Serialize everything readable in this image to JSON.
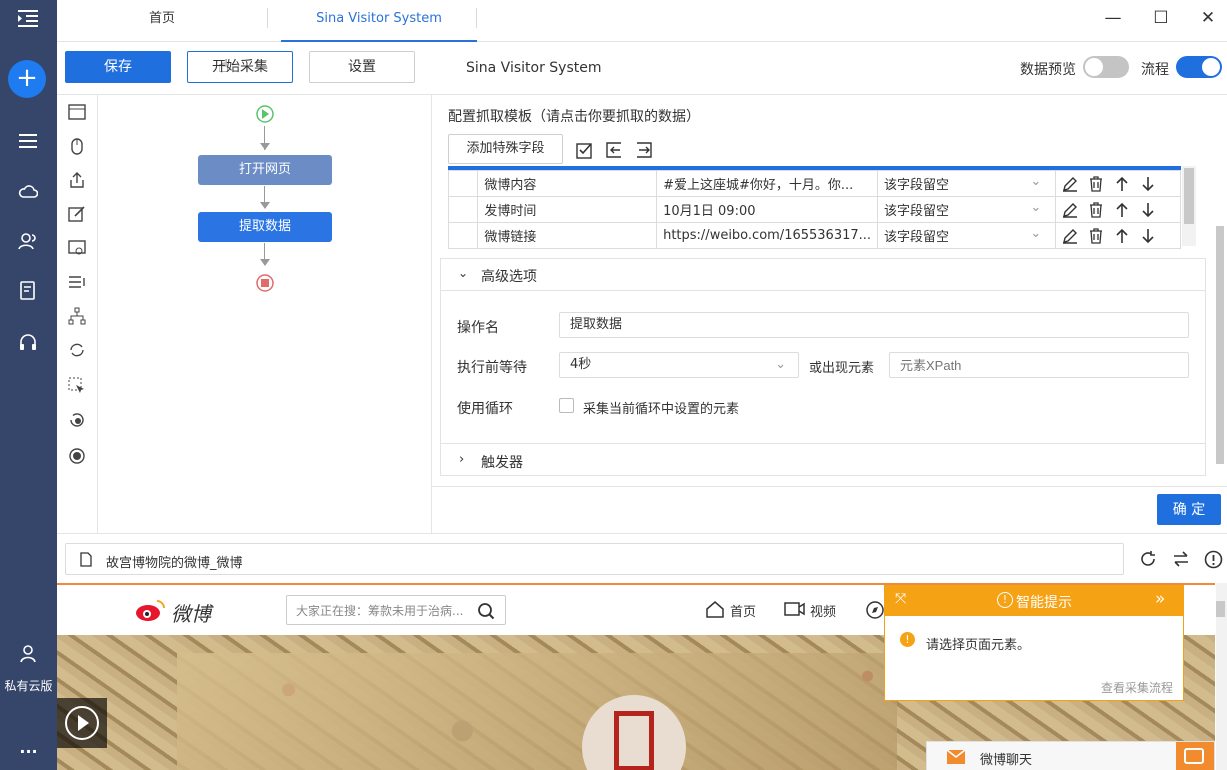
{
  "app": {
    "tabs": [
      {
        "label": "首页"
      },
      {
        "label": "Sina Visitor System"
      }
    ],
    "rail": {
      "cloud_label": "私有云版",
      "more_label": "..."
    }
  },
  "toolbar": {
    "save_label": "保存",
    "start_label": "开始采集",
    "settings_label": "设置",
    "task_title": "Sina Visitor System",
    "preview_label": "数据预览",
    "preview_on": false,
    "flow_label": "流程",
    "flow_on": true
  },
  "flow": {
    "nodes": [
      {
        "label": "打开网页"
      },
      {
        "label": "提取数据"
      }
    ]
  },
  "extract": {
    "heading": "配置抓取模板（请点击你要抓取的数据）",
    "add_special_label": "添加特殊字段",
    "rows": [
      {
        "name": "微博内容",
        "value": "#爱上这座城#你好，十月。你...",
        "option": "该字段留空"
      },
      {
        "name": "发博时间",
        "value": "10月1日 09:00",
        "option": "该字段留空"
      },
      {
        "name": "微博链接",
        "value": "https://weibo.com/165536317...",
        "option": "该字段留空"
      }
    ],
    "advanced_label": "高级选项",
    "op_name_label": "操作名",
    "op_name_value": "提取数据",
    "wait_label": "执行前等待",
    "wait_value": "4秒",
    "or_label": "或出现元素",
    "xpath_placeholder": "元素XPath",
    "loop_label": "使用循环",
    "loop_checkbox_label": "采集当前循环中设置的元素",
    "trigger_label": "触发器",
    "confirm_label": "确 定"
  },
  "browser": {
    "page_title": "故宫博物院的微博_微博"
  },
  "weibo": {
    "logo_text": "微博",
    "search_placeholder": "大家正在搜：筹款未用于治病...",
    "nav_home": "首页",
    "nav_video": "视频",
    "chat_label": "微博聊天"
  },
  "hint": {
    "title": "智能提示",
    "message": "请选择页面元素。",
    "link": "查看采集流程"
  },
  "colors": {
    "primary": "#1f6fdf",
    "rail": "#36466a",
    "hint": "#f5a214"
  }
}
